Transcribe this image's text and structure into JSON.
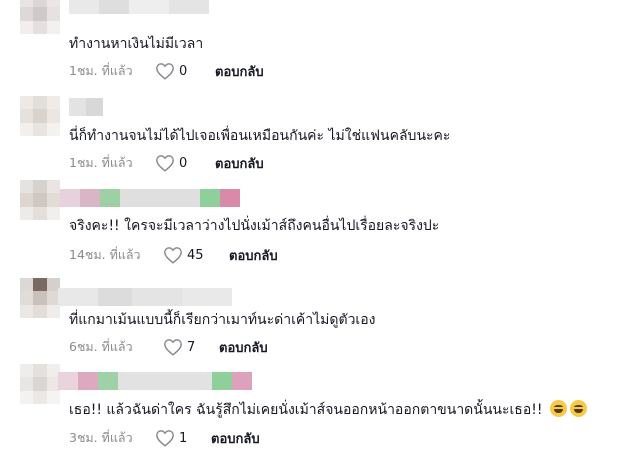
{
  "comments": [
    {
      "text": "ทำงานหาเงินไม่มีเวลา",
      "time": "1ชม. ที่แล้ว",
      "likes": "0",
      "reply": "ตอบกลับ",
      "emoji": ""
    },
    {
      "text": "นี่ก็ทำงานจนไม่ได้ไปเจอเพื่อนเหมือนกันค่ะ ไม่ใช่แฟนคลับนะคะ",
      "time": "1ชม. ที่แล้ว",
      "likes": "0",
      "reply": "ตอบกลับ",
      "emoji": ""
    },
    {
      "text": "จริงคะ!! ใครจะมีเวลาว่างไปนั่งเม้าส์ถึงคนอื่นไปเรื่อยละจริงปะ",
      "time": "14ชม. ที่แล้ว",
      "likes": "45",
      "reply": "ตอบกลับ",
      "emoji": ""
    },
    {
      "text": "ที่แกมาเม้นแบบนี้ก็เรียกว่าเมาท์นะด่าเค้าไม่ดูตัวเอง",
      "time": "6ชม. ที่แล้ว",
      "likes": "7",
      "reply": "ตอบกลับ",
      "emoji": ""
    },
    {
      "text": "เธอ!! แล้วฉันด่าใคร ฉันรู้สึกไม่เคยนั่งเม้าส์จนออกหน้าออกตาขนาดนั้นนะเธอ!!",
      "time": "3ชม. ที่แล้ว",
      "likes": "1",
      "reply": "ตอบกลับ",
      "emoji": "😂😂"
    }
  ],
  "icons": {
    "like": "heart-outline-icon",
    "emoji": "face-with-tears-of-joy-icon"
  },
  "colors": {
    "text": "#161823",
    "meta": "#8a8b91"
  }
}
